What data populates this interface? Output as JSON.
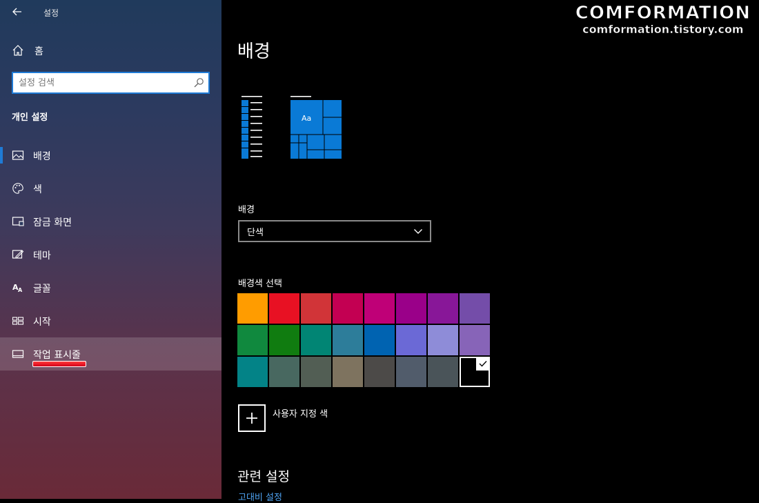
{
  "sidebar": {
    "app_title": "설정",
    "home_label": "홈",
    "search_placeholder": "설정 검색",
    "section_title": "개인 설정",
    "items": [
      {
        "label": "배경"
      },
      {
        "label": "색"
      },
      {
        "label": "잠금 화면"
      },
      {
        "label": "테마"
      },
      {
        "label": "글꼴"
      },
      {
        "label": "시작"
      },
      {
        "label": "작업 표시줄"
      }
    ]
  },
  "watermark": {
    "title": "COMFORMATION",
    "subtitle": "comformation.tistory.com"
  },
  "main": {
    "page_title": "배경",
    "preview_tile_text": "Aa",
    "background_label": "배경",
    "background_value": "단색",
    "color_label": "배경색 선택",
    "swatches": [
      "#ff9c00",
      "#e81123",
      "#d13438",
      "#c30052",
      "#bf0077",
      "#9a0089",
      "#881798",
      "#744da9",
      "#10893e",
      "#107c10",
      "#018574",
      "#2d7d9a",
      "#0063b1",
      "#6b69d6",
      "#8e8cd8",
      "#8764b8",
      "#038387",
      "#486860",
      "#525e54",
      "#7e735f",
      "#4c4a48",
      "#515c6b",
      "#4a5459",
      "#000000"
    ],
    "selected_swatch": 23,
    "custom_color_label": "사용자 지정 색",
    "related_title": "관련 설정",
    "related_link": "고대비 설정"
  },
  "colors": {
    "accent": "#1f7bd6",
    "link": "#4ea3f2",
    "sidebar_top": "#203a5c",
    "sidebar_bottom": "#6a2a38"
  },
  "icons": {
    "back": "arrow-left-icon",
    "home": "home-icon",
    "search": "search-icon",
    "nav": [
      "picture-icon",
      "palette-icon",
      "lock-screen-icon",
      "theme-icon",
      "font-icon",
      "start-icon",
      "taskbar-icon"
    ]
  }
}
